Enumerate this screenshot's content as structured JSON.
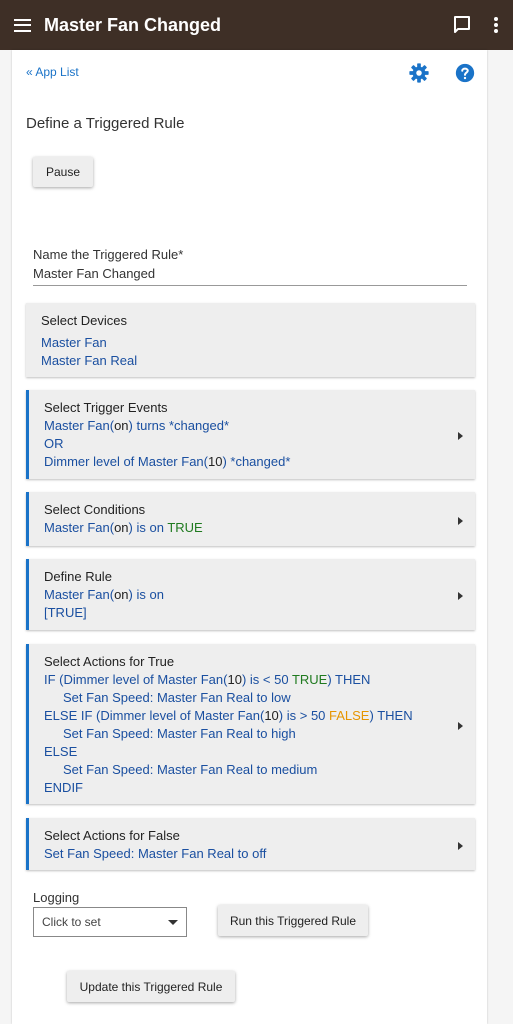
{
  "header": {
    "title": "Master Fan Changed"
  },
  "nav": {
    "app_list": "« App List"
  },
  "page": {
    "heading": "Define a Triggered Rule",
    "pause_label": "Pause",
    "name_label": "Name the Triggered Rule*",
    "name_value": "Master Fan Changed"
  },
  "devices": {
    "title": "Select Devices",
    "items": [
      "Master Fan",
      "Master Fan Real"
    ]
  },
  "triggers": {
    "title": "Select Trigger Events",
    "l1a": "Master Fan(",
    "l1b": "on",
    "l1c": ") turns *changed*",
    "or": "OR",
    "l2a": "Dimmer level of Master Fan(",
    "l2b": "10",
    "l2c": ") *changed*"
  },
  "conditions": {
    "title": "Select Conditions",
    "a": "Master Fan(",
    "b": "on",
    "c": ") is on ",
    "d": "TRUE"
  },
  "rule": {
    "title": "Define Rule",
    "a": "Master Fan(",
    "b": "on",
    "c": ") is on",
    "d": "[TRUE]"
  },
  "actions_true": {
    "title": "Select Actions for True",
    "if_a": "IF (Dimmer level of Master Fan(",
    "if_b": "10",
    "if_c": ") is < 50 ",
    "if_d": "TRUE",
    "if_e": ") THEN",
    "act1": "Set Fan Speed: Master Fan Real to low",
    "elif_a": "ELSE IF (Dimmer level of Master Fan(",
    "elif_b": "10",
    "elif_c": ") is > 50 ",
    "elif_d": "FALSE",
    "elif_e": ") THEN",
    "act2": "Set Fan Speed: Master Fan Real to high",
    "else": "ELSE",
    "act3": "Set Fan Speed: Master Fan Real to medium",
    "endif": "ENDIF"
  },
  "actions_false": {
    "title": "Select Actions for False",
    "act": "Set Fan Speed: Master Fan Real to off"
  },
  "logging": {
    "label": "Logging",
    "select_value": "Click to set"
  },
  "buttons": {
    "run": "Run this Triggered Rule",
    "update": "Update this Triggered Rule"
  },
  "colors": {
    "header_bg": "#3e2f26",
    "accent": "#1a73c8",
    "true_green": "#1f7a1f",
    "false_orange": "#e69500"
  }
}
